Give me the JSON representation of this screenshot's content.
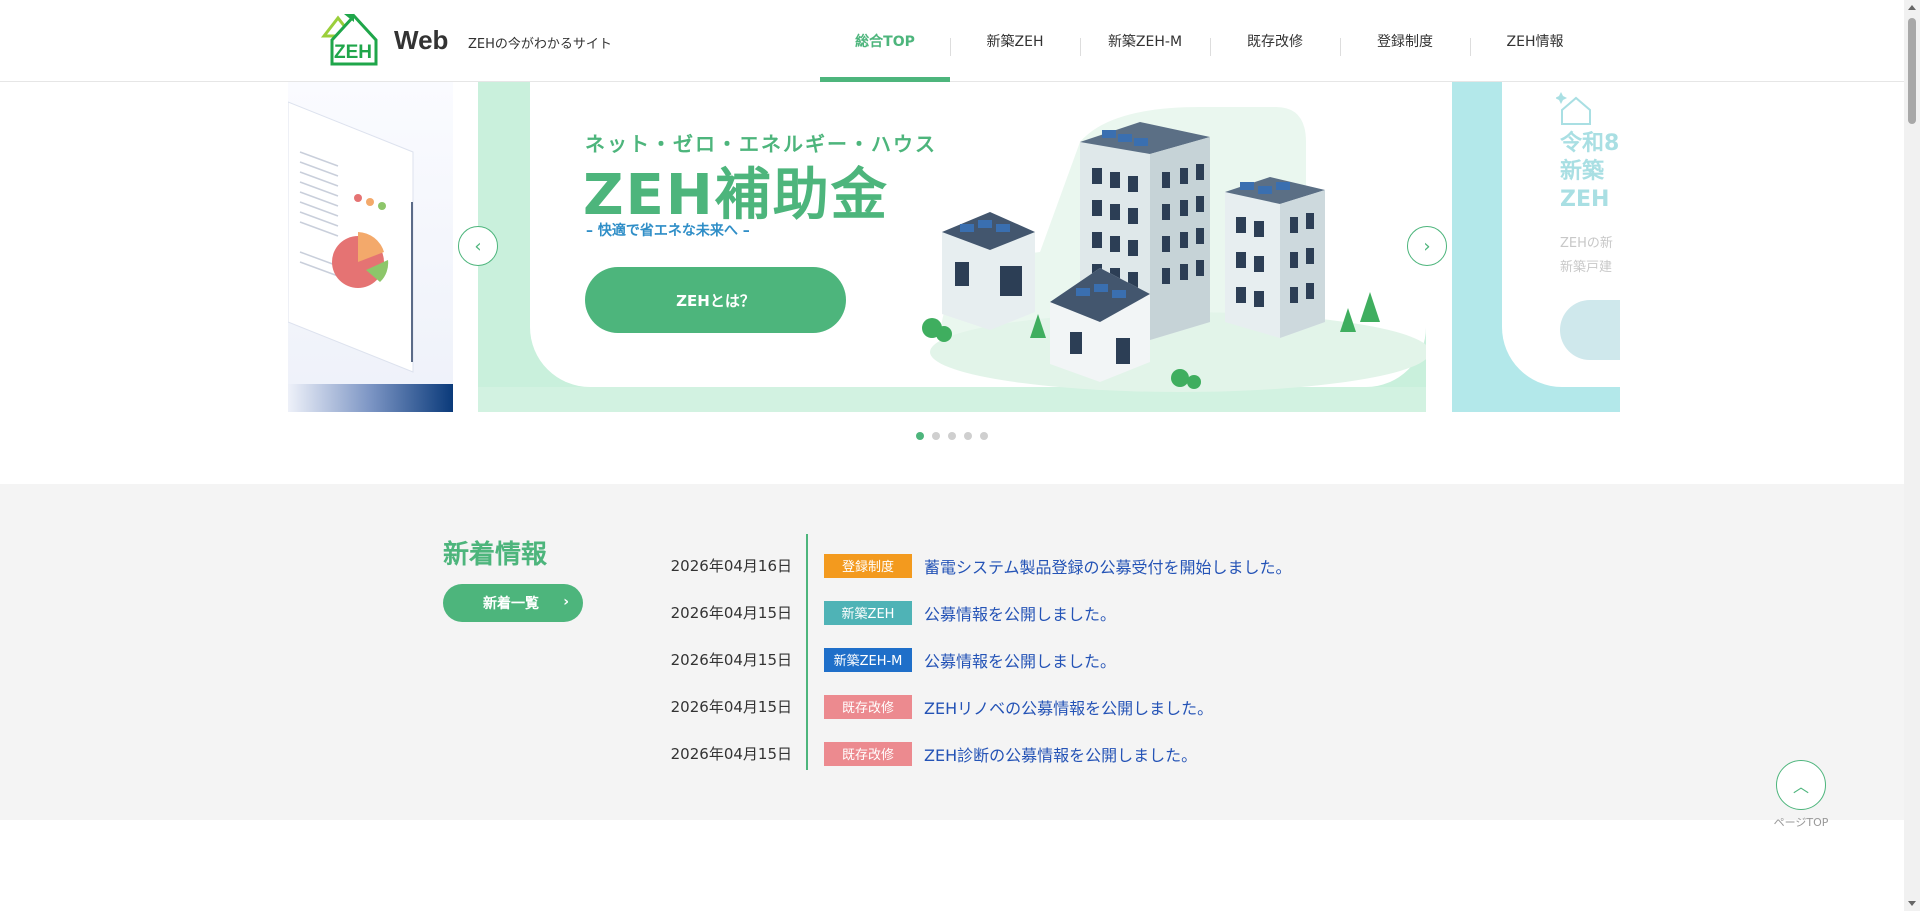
{
  "header": {
    "logo_text": "ZEH",
    "logo_suffix": "Web",
    "tagline": "ZEHの今がわかるサイト",
    "nav": [
      {
        "label": "総合TOP",
        "active": true
      },
      {
        "label": "新築ZEH",
        "active": false
      },
      {
        "label": "新築ZEH-M",
        "active": false
      },
      {
        "label": "既存改修",
        "active": false
      },
      {
        "label": "登録制度",
        "active": false
      },
      {
        "label": "ZEH情報",
        "active": false
      }
    ]
  },
  "hero": {
    "kicker": "ネット・ゼロ・エネルギー・ハウス",
    "title": "ZEH補助金",
    "subtitle": "– 快適で省エネな未来へ –",
    "button": "ZEHとは？",
    "prev_icon": "chevron-left-icon",
    "next_icon": "chevron-right-icon",
    "slide_count": 5,
    "active_slide": 1,
    "next_slide": {
      "title_line1": "令和8",
      "title_line2": "新築",
      "title_line3": "ZEH",
      "text_line1": "ZEHの新",
      "text_line2": "新築戸建"
    }
  },
  "news": {
    "heading": "新着情報",
    "all_button": "新着一覧",
    "items": [
      {
        "date": "2026年04月16日",
        "category": "登録制度",
        "color": "#f39a1e",
        "title": "蓄電システム製品登録の公募受付を開始しました。"
      },
      {
        "date": "2026年04月15日",
        "category": "新築ZEH",
        "color": "#4fb3b6",
        "title": "公募情報を公開しました。"
      },
      {
        "date": "2026年04月15日",
        "category": "新築ZEH-M",
        "color": "#1f6fc9",
        "title": "公募情報を公開しました。"
      },
      {
        "date": "2026年04月15日",
        "category": "既存改修",
        "color": "#ec8a8f",
        "title": "ZEHリノベの公募情報を公開しました。"
      },
      {
        "date": "2026年04月15日",
        "category": "既存改修",
        "color": "#ec8a8f",
        "title": "ZEH診断の公募情報を公開しました。"
      }
    ]
  },
  "page_top": {
    "label": "ページTOP",
    "icon": "chevron-up-icon"
  },
  "colors": {
    "accent": "#4db57c",
    "link": "#2453b6",
    "news_bg": "#f4f4f4"
  }
}
